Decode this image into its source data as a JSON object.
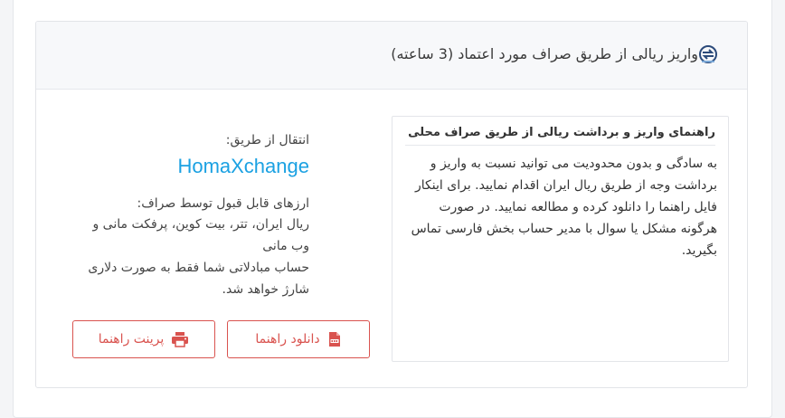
{
  "header": {
    "title": "واریز ریالی از طریق صراف مورد اعتماد (3 ساعته)",
    "logo_icon": "exchange-logo-icon"
  },
  "guide": {
    "title": "راهنمای واریز و برداشت ریالی از طریق صراف محلی",
    "text": "به سادگی و بدون محدودیت می توانید نسبت به واریز و برداشت وجه از طریق ریال ایران اقدام نمایید. برای اینکار فایل راهنما را دانلود کرده و مطالعه نمایید. در صورت هرگونه مشکل یا سوال با مدیر حساب بخش فارسی تماس بگیرید."
  },
  "details": {
    "transfer_label": "انتقال از طریق:",
    "exchange_name": "HomaXchange",
    "currencies_label": "ارزهای قابل قبول توسط صراف:",
    "currencies": "ریال ایران، تتر، بیت کوین، پرفکت مانی و وب مانی",
    "account_note": "حساب مبادلاتی شما فقط به صورت دلاری شارژ خواهد شد."
  },
  "buttons": {
    "download_label": "دانلود راهنما",
    "download_icon": "pdf-icon",
    "print_label": "پرینت راهنما",
    "print_icon": "printer-icon"
  },
  "colors": {
    "accent_blue": "#1ba1e2",
    "button_red": "#d9534f"
  }
}
